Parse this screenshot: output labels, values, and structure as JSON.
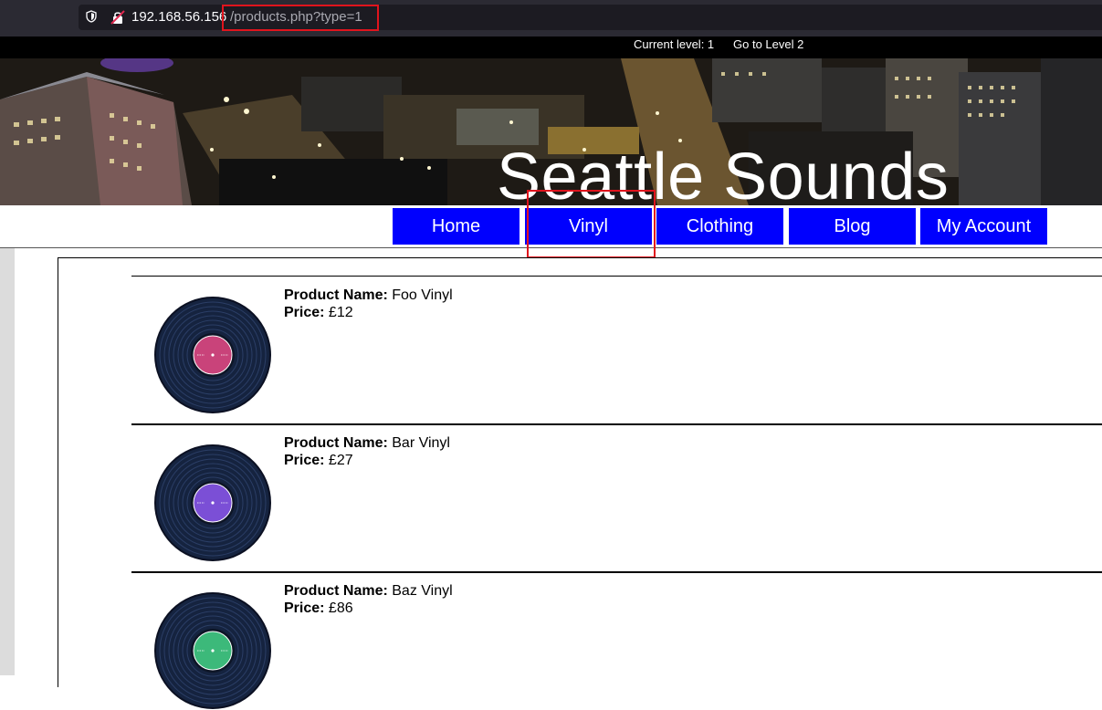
{
  "browser": {
    "url_host": "192.168.56.156",
    "url_path": "/products.php?type=1"
  },
  "levelbar": {
    "current_level": "Current level: 1",
    "go_to_level": "Go to Level 2"
  },
  "site": {
    "title": "Seattle Sounds"
  },
  "nav": {
    "items": [
      {
        "label": "Home"
      },
      {
        "label": "Vinyl"
      },
      {
        "label": "Clothing"
      },
      {
        "label": "Blog"
      },
      {
        "label": "My Account"
      }
    ]
  },
  "products": {
    "name_label": "Product Name:",
    "price_label": "Price:",
    "items": [
      {
        "name": "Foo Vinyl",
        "price": "£12",
        "label_color": "#c9437a"
      },
      {
        "name": "Bar Vinyl",
        "price": "£27",
        "label_color": "#7b4fd6"
      },
      {
        "name": "Baz Vinyl",
        "price": "£86",
        "label_color": "#3cb97a"
      }
    ]
  },
  "colors": {
    "nav_bg": "#0000fe",
    "highlight": "#e0141d"
  }
}
